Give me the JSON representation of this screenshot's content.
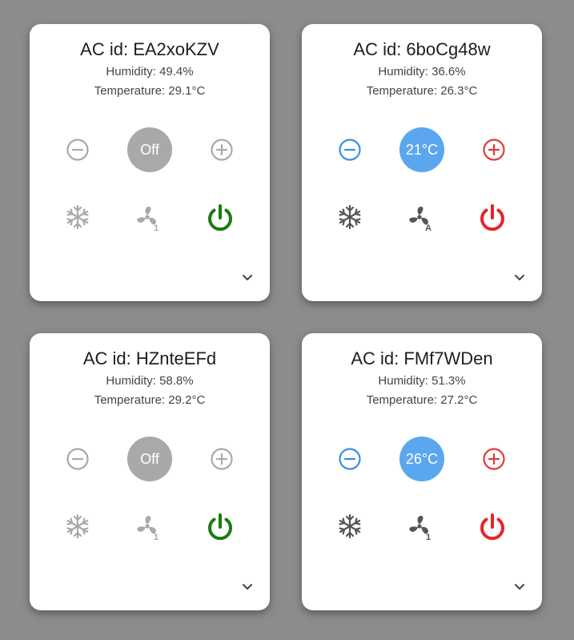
{
  "colors": {
    "page_background": "#8c8c8c",
    "card_background": "#ffffff",
    "inactive_grey": "#a9a9a9",
    "dark_icon": "#555555",
    "cool_blue": "#3b8fe0",
    "setpoint_on": "#5aa7f0",
    "heat_red": "#e03a3a",
    "power_green": "#1b7a12",
    "power_red": "#e8232a"
  },
  "cards": [
    {
      "title": "AC id: EA2xoKZV",
      "humidity": "Humidity: 49.4%",
      "temperature": "Temperature: 29.1°C",
      "setpoint": "Off",
      "state": "off",
      "fan_mode": "1",
      "icons": [
        "minus-circle-icon",
        "plus-circle-icon",
        "snowflake-icon",
        "fan-icon",
        "power-icon",
        "chevron-down-icon"
      ]
    },
    {
      "title": "AC id: 6boCg48w",
      "humidity": "Humidity: 36.6%",
      "temperature": "Temperature: 26.3°C",
      "setpoint": "21°C",
      "state": "on",
      "fan_mode": "A",
      "icons": [
        "minus-circle-icon",
        "plus-circle-icon",
        "snowflake-icon",
        "fan-icon",
        "power-icon",
        "chevron-down-icon"
      ]
    },
    {
      "title": "AC id: HZnteEFd",
      "humidity": "Humidity: 58.8%",
      "temperature": "Temperature: 29.2°C",
      "setpoint": "Off",
      "state": "off",
      "fan_mode": "1",
      "icons": [
        "minus-circle-icon",
        "plus-circle-icon",
        "snowflake-icon",
        "fan-icon",
        "power-icon",
        "chevron-down-icon"
      ]
    },
    {
      "title": "AC id: FMf7WDen",
      "humidity": "Humidity: 51.3%",
      "temperature": "Temperature: 27.2°C",
      "setpoint": "26°C",
      "state": "on",
      "fan_mode": "1",
      "icons": [
        "minus-circle-icon",
        "plus-circle-icon",
        "snowflake-icon",
        "fan-icon",
        "power-icon",
        "chevron-down-icon"
      ]
    }
  ]
}
